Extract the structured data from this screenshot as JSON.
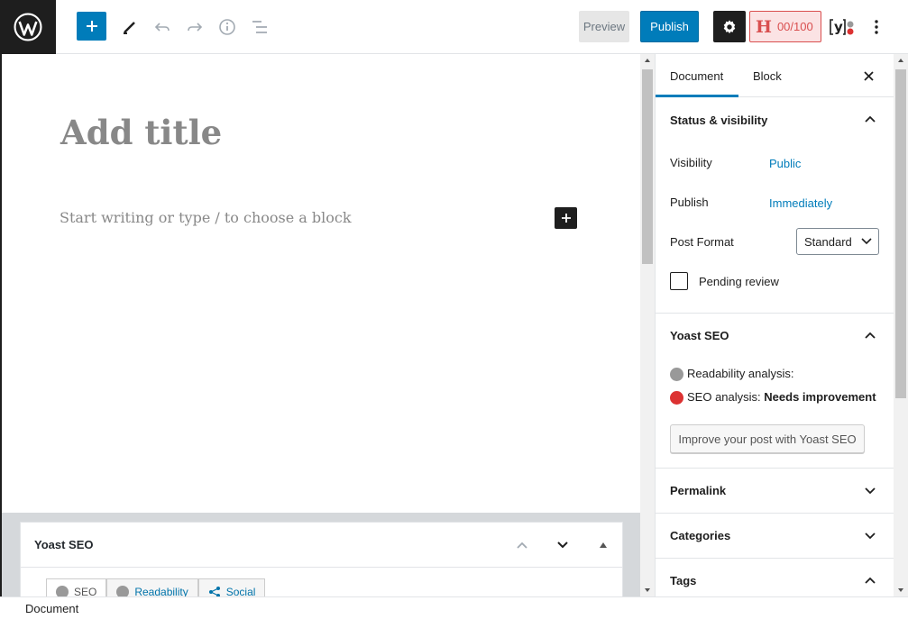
{
  "toolbar": {
    "preview_label": "Preview",
    "publish_label": "Publish",
    "seo_score": "00/100",
    "seo_score_letter": "H"
  },
  "editor": {
    "title_placeholder": "Add title",
    "block_placeholder": "Start writing or type / to choose a block"
  },
  "metabox": {
    "title": "Yoast SEO",
    "tabs": [
      {
        "label": "SEO"
      },
      {
        "label": "Readability"
      },
      {
        "label": "Social"
      }
    ]
  },
  "sidebar": {
    "tabs": [
      {
        "label": "Document"
      },
      {
        "label": "Block"
      }
    ],
    "status_visibility": {
      "title": "Status & visibility",
      "visibility_label": "Visibility",
      "visibility_value": "Public",
      "publish_label": "Publish",
      "publish_value": "Immediately",
      "post_format_label": "Post Format",
      "post_format_value": "Standard",
      "pending_review_label": "Pending review"
    },
    "yoast": {
      "title": "Yoast SEO",
      "readability_label": "Readability analysis:",
      "seo_label": "SEO analysis:",
      "seo_status": "Needs improvement",
      "improve_button": "Improve your post with Yoast SEO"
    },
    "panels": [
      {
        "title": "Permalink"
      },
      {
        "title": "Categories"
      },
      {
        "title": "Tags"
      }
    ]
  },
  "footer": {
    "breadcrumb": "Document"
  },
  "colors": {
    "accent": "#007cba",
    "seo_bad": "#dc3232",
    "dark": "#1e1e1e"
  }
}
